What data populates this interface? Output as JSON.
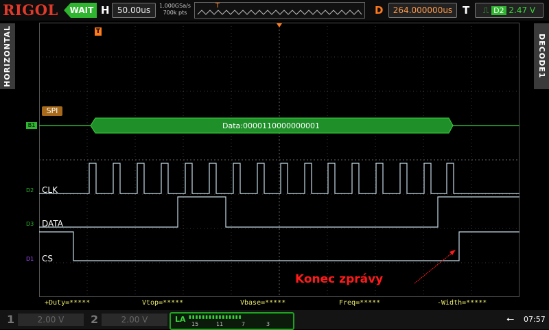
{
  "header": {
    "brand": "RIGOL",
    "status": "WAIT",
    "h_label": "H",
    "timebase": "50.00us",
    "sample_rate": "1.000GSa/s",
    "memory_depth": "700k pts",
    "trigger_marker": "T",
    "d_label": "D",
    "delay": "264.000000us",
    "t_label": "T",
    "trigger_source": "D2",
    "trigger_level": "2.47 V"
  },
  "side_tabs": {
    "left": "HORIZONTAL",
    "right": "DECODE1"
  },
  "screen": {
    "trigger_marker": "T",
    "bus_label": "SPI",
    "bus_channel": "B1",
    "bus_data": "Data:0000110000000001",
    "channels": [
      {
        "id": "D2",
        "name": "CLK"
      },
      {
        "id": "D3",
        "name": "DATA"
      },
      {
        "id": "D1",
        "name": "CS"
      }
    ],
    "annotation": "Konec zprávy"
  },
  "measurements": [
    "+Duty=*****",
    "Vtop=*****",
    "Vbase=*****",
    "Freq=*****",
    "-Width=*****"
  ],
  "footer": {
    "ch1_num": "1",
    "ch1_scale": "2.00 V",
    "ch2_num": "2",
    "ch2_scale": "2.00 V",
    "la_label": "LA",
    "la_ticks": [
      "15",
      "11",
      "7",
      "3"
    ],
    "time": "07:57"
  },
  "colors": {
    "brand": "#e23a2a",
    "status": "#2fb52f",
    "bus": "#1f8f2a",
    "trace": "#c8dde8",
    "trigger": "#ff7b1c",
    "annotation": "#ff1a1a"
  }
}
